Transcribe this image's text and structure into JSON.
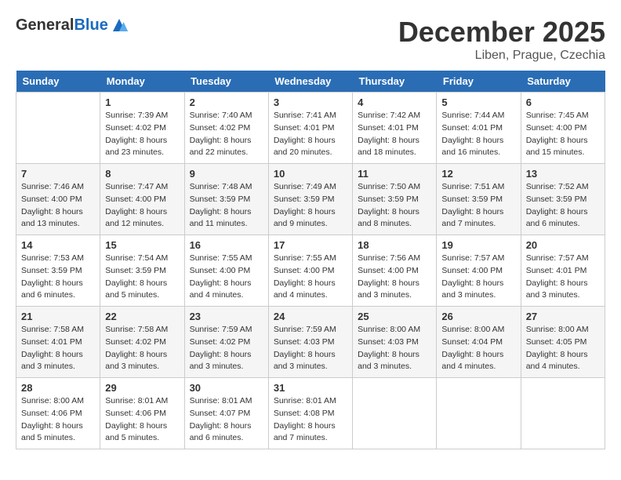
{
  "header": {
    "logo_general": "General",
    "logo_blue": "Blue",
    "month_title": "December 2025",
    "location": "Liben, Prague, Czechia"
  },
  "weekdays": [
    "Sunday",
    "Monday",
    "Tuesday",
    "Wednesday",
    "Thursday",
    "Friday",
    "Saturday"
  ],
  "weeks": [
    [
      {
        "day": "",
        "info": ""
      },
      {
        "day": "1",
        "info": "Sunrise: 7:39 AM\nSunset: 4:02 PM\nDaylight: 8 hours\nand 23 minutes."
      },
      {
        "day": "2",
        "info": "Sunrise: 7:40 AM\nSunset: 4:02 PM\nDaylight: 8 hours\nand 22 minutes."
      },
      {
        "day": "3",
        "info": "Sunrise: 7:41 AM\nSunset: 4:01 PM\nDaylight: 8 hours\nand 20 minutes."
      },
      {
        "day": "4",
        "info": "Sunrise: 7:42 AM\nSunset: 4:01 PM\nDaylight: 8 hours\nand 18 minutes."
      },
      {
        "day": "5",
        "info": "Sunrise: 7:44 AM\nSunset: 4:01 PM\nDaylight: 8 hours\nand 16 minutes."
      },
      {
        "day": "6",
        "info": "Sunrise: 7:45 AM\nSunset: 4:00 PM\nDaylight: 8 hours\nand 15 minutes."
      }
    ],
    [
      {
        "day": "7",
        "info": "Sunrise: 7:46 AM\nSunset: 4:00 PM\nDaylight: 8 hours\nand 13 minutes."
      },
      {
        "day": "8",
        "info": "Sunrise: 7:47 AM\nSunset: 4:00 PM\nDaylight: 8 hours\nand 12 minutes."
      },
      {
        "day": "9",
        "info": "Sunrise: 7:48 AM\nSunset: 3:59 PM\nDaylight: 8 hours\nand 11 minutes."
      },
      {
        "day": "10",
        "info": "Sunrise: 7:49 AM\nSunset: 3:59 PM\nDaylight: 8 hours\nand 9 minutes."
      },
      {
        "day": "11",
        "info": "Sunrise: 7:50 AM\nSunset: 3:59 PM\nDaylight: 8 hours\nand 8 minutes."
      },
      {
        "day": "12",
        "info": "Sunrise: 7:51 AM\nSunset: 3:59 PM\nDaylight: 8 hours\nand 7 minutes."
      },
      {
        "day": "13",
        "info": "Sunrise: 7:52 AM\nSunset: 3:59 PM\nDaylight: 8 hours\nand 6 minutes."
      }
    ],
    [
      {
        "day": "14",
        "info": "Sunrise: 7:53 AM\nSunset: 3:59 PM\nDaylight: 8 hours\nand 6 minutes."
      },
      {
        "day": "15",
        "info": "Sunrise: 7:54 AM\nSunset: 3:59 PM\nDaylight: 8 hours\nand 5 minutes."
      },
      {
        "day": "16",
        "info": "Sunrise: 7:55 AM\nSunset: 4:00 PM\nDaylight: 8 hours\nand 4 minutes."
      },
      {
        "day": "17",
        "info": "Sunrise: 7:55 AM\nSunset: 4:00 PM\nDaylight: 8 hours\nand 4 minutes."
      },
      {
        "day": "18",
        "info": "Sunrise: 7:56 AM\nSunset: 4:00 PM\nDaylight: 8 hours\nand 3 minutes."
      },
      {
        "day": "19",
        "info": "Sunrise: 7:57 AM\nSunset: 4:00 PM\nDaylight: 8 hours\nand 3 minutes."
      },
      {
        "day": "20",
        "info": "Sunrise: 7:57 AM\nSunset: 4:01 PM\nDaylight: 8 hours\nand 3 minutes."
      }
    ],
    [
      {
        "day": "21",
        "info": "Sunrise: 7:58 AM\nSunset: 4:01 PM\nDaylight: 8 hours\nand 3 minutes."
      },
      {
        "day": "22",
        "info": "Sunrise: 7:58 AM\nSunset: 4:02 PM\nDaylight: 8 hours\nand 3 minutes."
      },
      {
        "day": "23",
        "info": "Sunrise: 7:59 AM\nSunset: 4:02 PM\nDaylight: 8 hours\nand 3 minutes."
      },
      {
        "day": "24",
        "info": "Sunrise: 7:59 AM\nSunset: 4:03 PM\nDaylight: 8 hours\nand 3 minutes."
      },
      {
        "day": "25",
        "info": "Sunrise: 8:00 AM\nSunset: 4:03 PM\nDaylight: 8 hours\nand 3 minutes."
      },
      {
        "day": "26",
        "info": "Sunrise: 8:00 AM\nSunset: 4:04 PM\nDaylight: 8 hours\nand 4 minutes."
      },
      {
        "day": "27",
        "info": "Sunrise: 8:00 AM\nSunset: 4:05 PM\nDaylight: 8 hours\nand 4 minutes."
      }
    ],
    [
      {
        "day": "28",
        "info": "Sunrise: 8:00 AM\nSunset: 4:06 PM\nDaylight: 8 hours\nand 5 minutes."
      },
      {
        "day": "29",
        "info": "Sunrise: 8:01 AM\nSunset: 4:06 PM\nDaylight: 8 hours\nand 5 minutes."
      },
      {
        "day": "30",
        "info": "Sunrise: 8:01 AM\nSunset: 4:07 PM\nDaylight: 8 hours\nand 6 minutes."
      },
      {
        "day": "31",
        "info": "Sunrise: 8:01 AM\nSunset: 4:08 PM\nDaylight: 8 hours\nand 7 minutes."
      },
      {
        "day": "",
        "info": ""
      },
      {
        "day": "",
        "info": ""
      },
      {
        "day": "",
        "info": ""
      }
    ]
  ]
}
